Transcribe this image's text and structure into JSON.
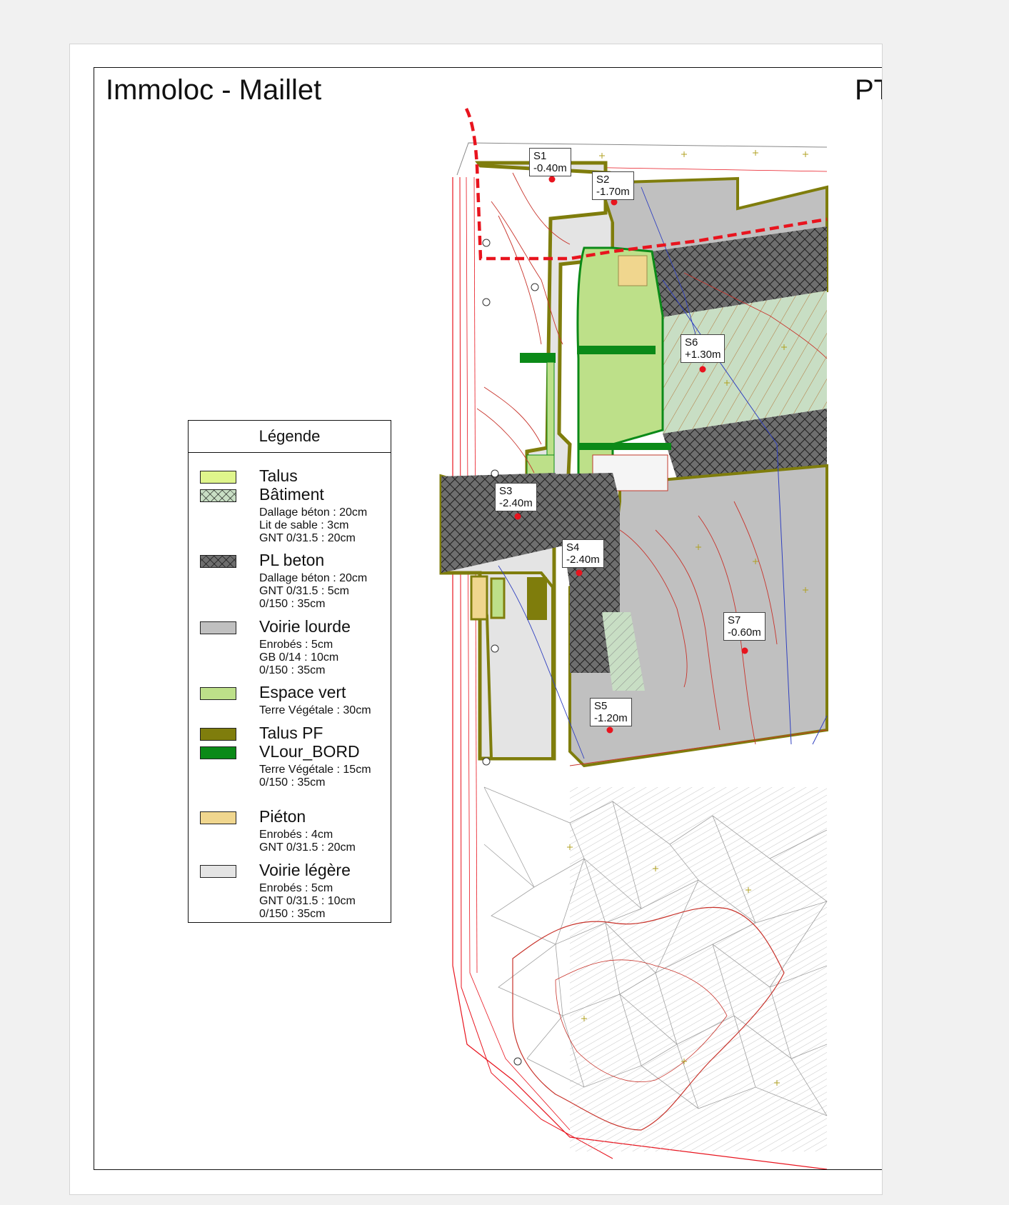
{
  "document": {
    "title": "Immoloc - Maillet",
    "code_fragment": "PT"
  },
  "legend": {
    "title": "Légende",
    "items": [
      {
        "label": "Talus",
        "color": "#dff58c",
        "hatch": false,
        "details": []
      },
      {
        "label": "Bâtiment",
        "color": "#c8dec4",
        "hatch": true,
        "details": [
          "Dallage béton : 20cm",
          "Lit de sable : 3cm",
          "GNT 0/31.5 : 20cm"
        ]
      },
      {
        "label": "PL beton",
        "color": "#6e6e6e",
        "hatch": true,
        "details": [
          "Dallage béton : 20cm",
          "GNT 0/31.5 : 5cm",
          "0/150 : 35cm"
        ]
      },
      {
        "label": "Voirie lourde",
        "color": "#c0c0c0",
        "hatch": false,
        "details": [
          "Enrobés : 5cm",
          "GB 0/14 : 10cm",
          "0/150 : 35cm"
        ]
      },
      {
        "label": "Espace vert",
        "color": "#bde089",
        "hatch": false,
        "details": [
          "Terre Végétale : 30cm"
        ]
      },
      {
        "label": "Talus PF",
        "color": "#7f7d0c",
        "hatch": false,
        "details": []
      },
      {
        "label": "VLour_BORD",
        "color": "#0b8a18",
        "hatch": false,
        "details": [
          "Terre Végétale : 15cm",
          "0/150 : 35cm"
        ]
      },
      {
        "label": "Piéton",
        "color": "#f0d68e",
        "hatch": false,
        "details": [
          "Enrobés : 4cm",
          "GNT 0/31.5 : 20cm"
        ]
      },
      {
        "label": "Voirie légère",
        "color": "#e4e4e4",
        "hatch": false,
        "details": [
          "Enrobés : 5cm",
          "GNT 0/31.5 : 10cm",
          "0/150 : 35cm"
        ]
      }
    ]
  },
  "survey_points": [
    {
      "id": "S1",
      "value": "-0.40m"
    },
    {
      "id": "S2",
      "value": "-1.70m"
    },
    {
      "id": "S3",
      "value": "-2.40m"
    },
    {
      "id": "S4",
      "value": "-2.40m"
    },
    {
      "id": "S5",
      "value": "-1.20m"
    },
    {
      "id": "S6",
      "value": "+1.30m"
    },
    {
      "id": "S7",
      "value": "-0.60m"
    }
  ],
  "colors": {
    "limit_red": "#e8141e",
    "contour_red": "#c8332b",
    "tin_gray": "#9a9a9a",
    "blue_line": "#3040c0"
  }
}
